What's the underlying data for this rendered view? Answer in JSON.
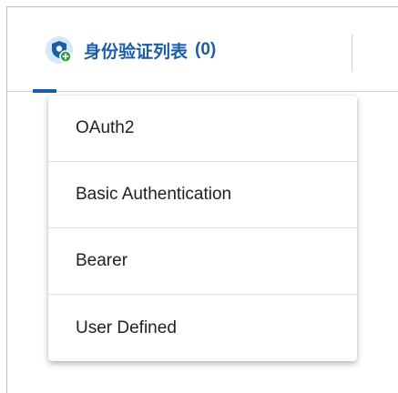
{
  "tab": {
    "label": "身份验证列表",
    "count": "(0)",
    "icon": "shield-add-icon",
    "accent_color": "#1a5ea8",
    "badge_color": "#2e9d4a"
  },
  "menu": {
    "items": [
      {
        "label": "OAuth2"
      },
      {
        "label": "Basic Authentication"
      },
      {
        "label": "Bearer"
      },
      {
        "label": "User Defined"
      }
    ]
  }
}
